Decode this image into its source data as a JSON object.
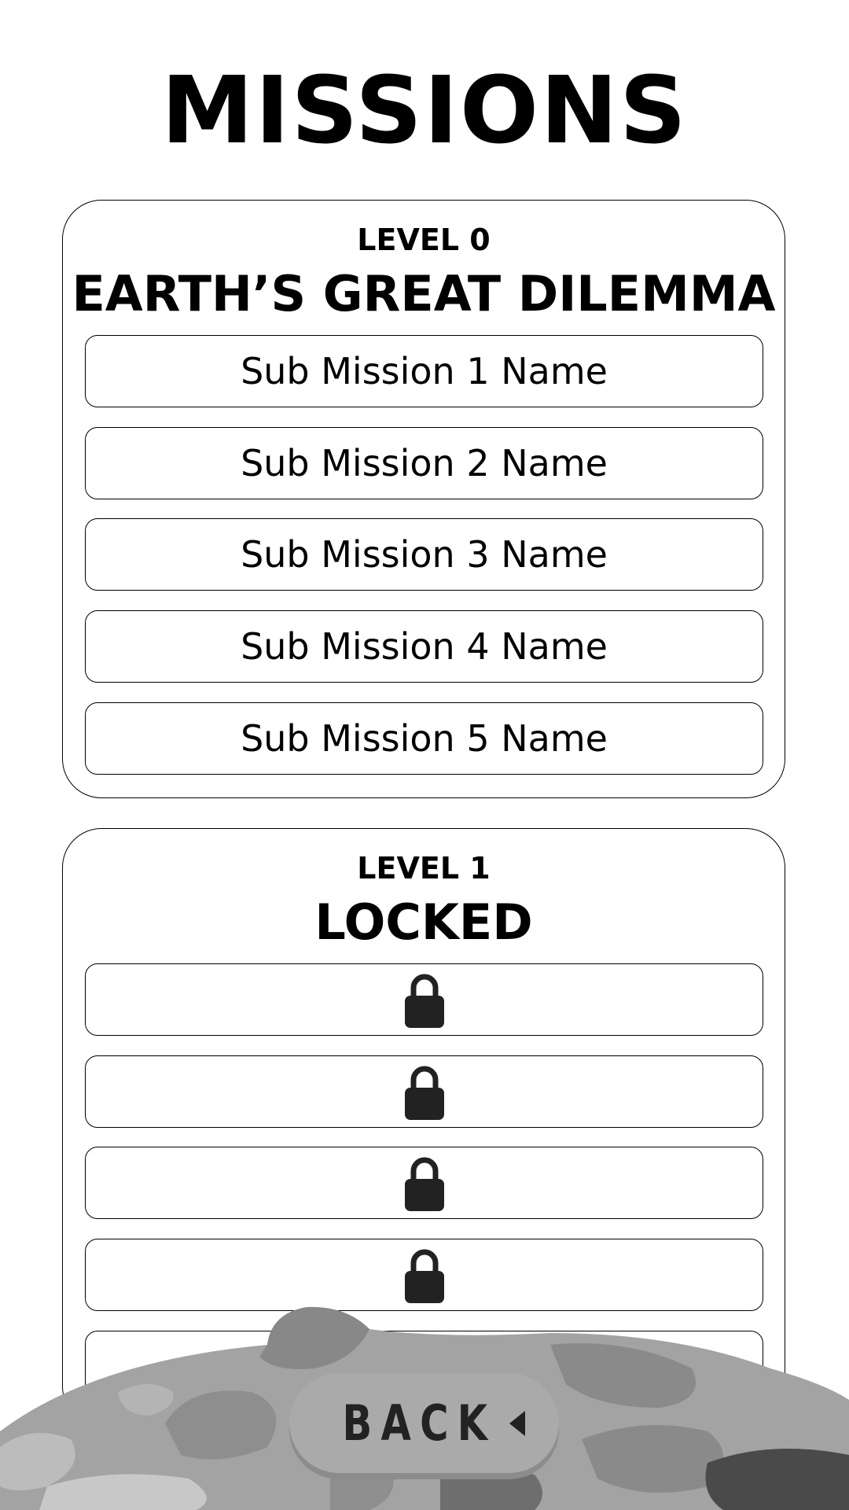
{
  "page": {
    "title": "MISSIONS"
  },
  "levels": [
    {
      "label": "LEVEL 0",
      "title": "EARTH’S GREAT DILEMMA",
      "missions": [
        "Sub Mission 1 Name",
        "Sub Mission 2 Name",
        "Sub Mission 3 Name",
        "Sub Mission 4 Name",
        "Sub Mission 5 Name"
      ]
    },
    {
      "label": "LEVEL 1",
      "title": "LOCKED",
      "locked_slots": [
        "lock-icon",
        "lock-icon",
        "lock-icon",
        "lock-icon",
        "lock-icon"
      ]
    }
  ],
  "back_button": {
    "label": "BACK",
    "icon": "triangle-left-icon"
  },
  "colors": {
    "background": "#ffffff",
    "border": "#000000",
    "button_grey": "#aaaaaa",
    "lock": "#222222"
  }
}
